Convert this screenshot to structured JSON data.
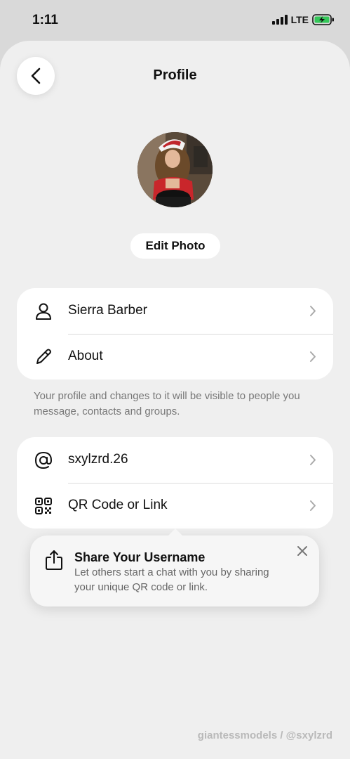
{
  "status_bar": {
    "time": "1:11",
    "network": "LTE",
    "battery_charging": true
  },
  "header": {
    "title": "Profile",
    "back_icon": "chevron-left-icon"
  },
  "profile": {
    "avatar_alt": "profile-photo",
    "edit_photo_label": "Edit Photo"
  },
  "info_card": {
    "items": [
      {
        "icon": "person-icon",
        "label": "Sierra Barber"
      },
      {
        "icon": "pencil-icon",
        "label": "About"
      }
    ]
  },
  "footnote": "Your profile and changes to it will be visible to people you message, contacts and groups.",
  "username_card": {
    "items": [
      {
        "icon": "at-icon",
        "label": "sxylzrd.26"
      },
      {
        "icon": "qr-code-icon",
        "label": "QR Code or Link"
      }
    ]
  },
  "tooltip": {
    "icon": "share-icon",
    "title": "Share Your Username",
    "body": "Let others start a chat with you by sharing your unique QR code or link."
  },
  "watermark": "giantessmodels / @sxylzrd"
}
